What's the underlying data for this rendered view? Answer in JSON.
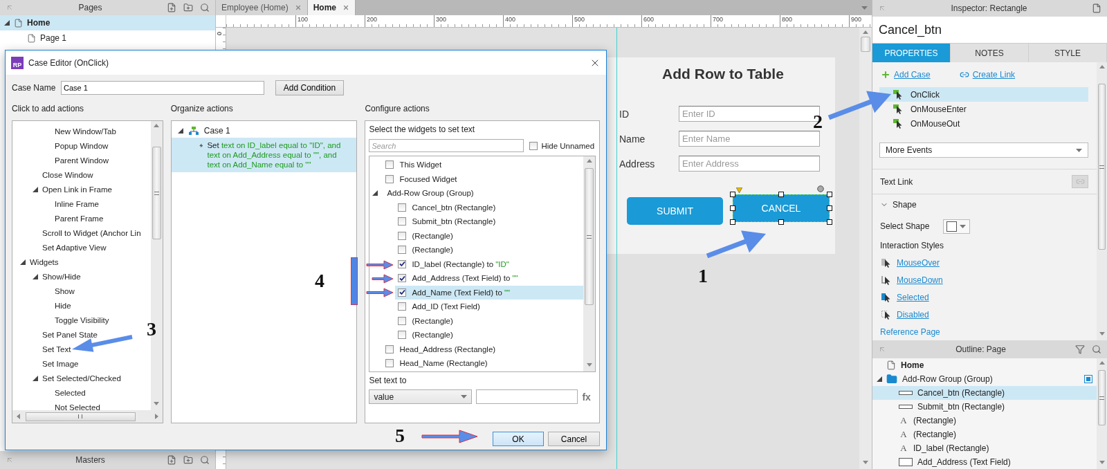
{
  "pages_panel": {
    "title": "Pages",
    "tree": [
      {
        "label": "Home",
        "selected": true,
        "expanded": true,
        "children": [
          {
            "label": "Page 1",
            "selected": false
          }
        ]
      }
    ]
  },
  "doc_tabs": [
    {
      "label": "Employee (Home)",
      "selected": false
    },
    {
      "label": "Home",
      "selected": true
    }
  ],
  "ruler": {
    "x_ticks": [
      "100",
      "200",
      "300",
      "400",
      "500",
      "600",
      "700",
      "800",
      "900"
    ],
    "y_ticks": [
      "0"
    ]
  },
  "canvas": {
    "title": "Add Row to Table",
    "fields": [
      {
        "label": "ID",
        "placeholder": "Enter ID"
      },
      {
        "label": "Name",
        "placeholder": "Enter Name"
      },
      {
        "label": "Address",
        "placeholder": "Enter Address"
      }
    ],
    "buttons": [
      {
        "label": "SUBMIT",
        "selected": false
      },
      {
        "label": "CANCEL",
        "selected": true
      }
    ]
  },
  "masters_panel": {
    "title": "Masters"
  },
  "dialog": {
    "title": "Case Editor (OnClick)",
    "icon_text": "RP",
    "case_name": {
      "label": "Case Name",
      "value": "Case 1"
    },
    "add_condition": "Add Condition",
    "actions_panel": {
      "title": "Click to add actions",
      "tree": [
        {
          "kind": "continuation",
          "children": [
            {
              "kind": "continuation",
              "children": [
                {
                  "kind": "action",
                  "label": "New Window/Tab"
                },
                {
                  "kind": "action",
                  "label": "Popup Window"
                },
                {
                  "kind": "action",
                  "label": "Parent Window"
                }
              ]
            },
            {
              "kind": "action",
              "label": "Close Window"
            },
            {
              "kind": "folder",
              "label": "Open Link in Frame",
              "expanded": true,
              "children": [
                {
                  "kind": "action",
                  "label": "Inline Frame"
                },
                {
                  "kind": "action",
                  "label": "Parent Frame"
                }
              ]
            },
            {
              "kind": "action",
              "label": "Scroll to Widget (Anchor Lin"
            },
            {
              "kind": "action",
              "label": "Set Adaptive View"
            }
          ]
        },
        {
          "kind": "folder",
          "label": "Widgets",
          "expanded": true,
          "children": [
            {
              "kind": "folder",
              "label": "Show/Hide",
              "expanded": true,
              "children": [
                {
                  "kind": "action",
                  "label": "Show"
                },
                {
                  "kind": "action",
                  "label": "Hide"
                },
                {
                  "kind": "action",
                  "label": "Toggle Visibility"
                }
              ]
            },
            {
              "kind": "action",
              "label": "Set Panel State"
            },
            {
              "kind": "action",
              "label": "Set Text"
            },
            {
              "kind": "action",
              "label": "Set Image"
            },
            {
              "kind": "folder",
              "label": "Set Selected/Checked",
              "expanded": true,
              "children": [
                {
                  "kind": "action",
                  "label": "Selected"
                },
                {
                  "kind": "action",
                  "label": "Not Selected"
                }
              ]
            }
          ]
        }
      ]
    },
    "organize_panel": {
      "title": "Organize actions",
      "cases": [
        {
          "label": "Case 1",
          "expanded": true,
          "actions": [
            {
              "verb": "Set",
              "detail": "text on ID_label equal to \"ID\", and text on Add_Address equal to \"\", and text on Add_Name equal to \"\"",
              "selected": true
            }
          ]
        }
      ]
    },
    "configure_panel": {
      "title": "Configure actions",
      "prompt": "Select the widgets to set text",
      "search": {
        "placeholder": "Search"
      },
      "hide_unnamed": {
        "label": "Hide Unnamed",
        "checked": false
      },
      "widgets": [
        {
          "kind": "widget",
          "label": "This Widget",
          "checked": false,
          "selected": false
        },
        {
          "kind": "widget",
          "label": "Focused Widget",
          "checked": false,
          "selected": false
        },
        {
          "kind": "group",
          "label": "Add-Row Group (Group)",
          "expanded": true,
          "selected": false,
          "children": [
            {
              "kind": "widget",
              "label": "Cancel_btn (Rectangle)",
              "checked": false,
              "selected": false
            },
            {
              "kind": "widget",
              "label": "Submit_btn (Rectangle)",
              "checked": false,
              "selected": false
            },
            {
              "kind": "widget",
              "label": "(Rectangle)",
              "checked": false,
              "selected": false
            },
            {
              "kind": "widget",
              "label": "(Rectangle)",
              "checked": false,
              "selected": false
            },
            {
              "kind": "widget",
              "label": "ID_label (Rectangle) to",
              "value": "\"ID\"",
              "checked": true,
              "selected": false
            },
            {
              "kind": "widget",
              "label": "Add_Address (Text Field) to",
              "value": "\"\"",
              "checked": true,
              "selected": false
            },
            {
              "kind": "widget",
              "label": "Add_Name (Text Field) to",
              "value": "\"\"",
              "checked": true,
              "selected": true
            },
            {
              "kind": "widget",
              "label": "Add_ID (Text Field)",
              "checked": false,
              "selected": false
            },
            {
              "kind": "widget",
              "label": "(Rectangle)",
              "checked": false,
              "selected": false
            },
            {
              "kind": "widget",
              "label": "(Rectangle)",
              "checked": false,
              "selected": false
            }
          ]
        },
        {
          "kind": "widget",
          "label": "Head_Address (Rectangle)",
          "checked": false,
          "selected": false
        },
        {
          "kind": "widget",
          "label": "Head_Name (Rectangle)",
          "checked": false,
          "selected": false
        }
      ],
      "set_text_label": "Set text to",
      "value_type": "value",
      "fx": "fx"
    },
    "buttons": [
      {
        "label": "OK",
        "kind": "default"
      },
      {
        "label": "Cancel",
        "kind": "normal"
      }
    ]
  },
  "inspector": {
    "title": "Inspector: Rectangle",
    "widget_name": "Cancel_btn",
    "tabs": [
      {
        "label": "PROPERTIES",
        "selected": true
      },
      {
        "label": "NOTES",
        "selected": false
      },
      {
        "label": "STYLE",
        "selected": false
      }
    ],
    "add_case": "Add Case",
    "create_link": "Create Link",
    "events": [
      {
        "label": "OnClick",
        "selected": true
      },
      {
        "label": "OnMouseEnter",
        "selected": false
      },
      {
        "label": "OnMouseOut",
        "selected": false
      }
    ],
    "more_events": "More Events",
    "text_link": "Text Link",
    "shape_section": {
      "title": "Shape",
      "expanded": true
    },
    "select_shape": "Select Shape",
    "interaction_styles": {
      "title": "Interaction Styles",
      "links": [
        {
          "kind": "over",
          "label": "MouseOver"
        },
        {
          "kind": "down",
          "label": "MouseDown"
        },
        {
          "kind": "selected",
          "label": "Selected"
        },
        {
          "kind": "disabled",
          "label": "Disabled"
        }
      ]
    },
    "reference_page": "Reference Page"
  },
  "outline": {
    "title": "Outline: Page",
    "tree": [
      {
        "kind": "page",
        "label": "Home",
        "selected": false
      },
      {
        "kind": "group",
        "label": "Add-Row Group (Group)",
        "expanded": true,
        "selected": false,
        "children": [
          {
            "kind": "rectangle",
            "label": "Cancel_btn (Rectangle)",
            "selected": true
          },
          {
            "kind": "rectangle",
            "label": "Submit_btn (Rectangle)",
            "selected": false
          },
          {
            "kind": "text",
            "glyph": "A",
            "label": "(Rectangle)",
            "selected": false
          },
          {
            "kind": "text",
            "glyph": "A",
            "label": "(Rectangle)",
            "selected": false
          },
          {
            "kind": "text",
            "glyph": "A",
            "label": "ID_label (Rectangle)",
            "selected": false
          },
          {
            "kind": "field",
            "label": "Add_Address (Text Field)",
            "selected": false
          }
        ]
      }
    ]
  },
  "annotations": [
    {
      "label": "1"
    },
    {
      "label": "2"
    },
    {
      "label": "3"
    },
    {
      "label": "4"
    },
    {
      "label": "5"
    }
  ]
}
